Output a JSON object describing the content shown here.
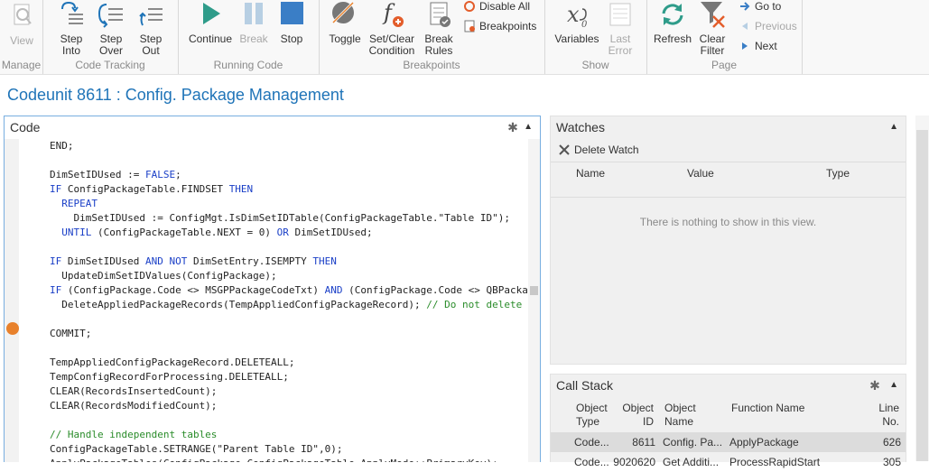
{
  "ribbon": {
    "manage": {
      "label": "Manage",
      "view": "View"
    },
    "code_tracking": {
      "label": "Code Tracking",
      "step_into": [
        "Step",
        "Into"
      ],
      "step_over": [
        "Step",
        "Over"
      ],
      "step_out": [
        "Step",
        "Out"
      ]
    },
    "running_code": {
      "label": "Running Code",
      "continue": "Continue",
      "break": "Break",
      "stop": "Stop"
    },
    "breakpoints": {
      "label": "Breakpoints",
      "toggle": "Toggle",
      "set_clear": [
        "Set/Clear",
        "Condition"
      ],
      "break_rules": [
        "Break",
        "Rules"
      ],
      "disable_all": "Disable All",
      "breakpoints": "Breakpoints"
    },
    "show": {
      "label": "Show",
      "variables": "Variables",
      "last_error": [
        "Last",
        "Error"
      ]
    },
    "page": {
      "label": "Page",
      "refresh": "Refresh",
      "clear_filter": [
        "Clear",
        "Filter"
      ],
      "go_to": "Go to",
      "previous": "Previous",
      "next": "Next"
    }
  },
  "page_title": "Codeunit 8611 : Config. Package Management",
  "code_panel": {
    "title": "Code",
    "lines": [
      [
        [
          "",
          "END;"
        ]
      ],
      [
        [
          "",
          ""
        ]
      ],
      [
        [
          "",
          "DimSetIDUsed := "
        ],
        [
          "kw",
          "FALSE"
        ],
        [
          "",
          ";"
        ]
      ],
      [
        [
          "kw",
          "IF"
        ],
        [
          "",
          " ConfigPackageTable.FINDSET "
        ],
        [
          "kw",
          "THEN"
        ]
      ],
      [
        [
          "kw",
          "  REPEAT"
        ]
      ],
      [
        [
          "",
          "    DimSetIDUsed := ConfigMgt.IsDimSetIDTable(ConfigPackageTable.\"Table ID\");"
        ]
      ],
      [
        [
          "kw",
          "  UNTIL"
        ],
        [
          "",
          " (ConfigPackageTable.NEXT = 0) "
        ],
        [
          "kw",
          "OR"
        ],
        [
          "",
          " DimSetIDUsed;"
        ]
      ],
      [
        [
          "",
          ""
        ]
      ],
      [
        [
          "kw",
          "IF"
        ],
        [
          "",
          " DimSetIDUsed "
        ],
        [
          "kw",
          "AND NOT"
        ],
        [
          "",
          " DimSetEntry.ISEMPTY "
        ],
        [
          "kw",
          "THEN"
        ]
      ],
      [
        [
          "",
          "  UpdateDimSetIDValues(ConfigPackage);"
        ]
      ],
      [
        [
          "kw",
          "IF"
        ],
        [
          "",
          " (ConfigPackage.Code <> MSGPPackageCodeTxt) "
        ],
        [
          "kw",
          "AND"
        ],
        [
          "",
          " (ConfigPackage.Code <> QBPacka"
        ]
      ],
      [
        [
          "",
          "  DeleteAppliedPackageRecords(TempAppliedConfigPackageRecord); "
        ],
        [
          "cm",
          "// Do not delete"
        ]
      ],
      [
        [
          "",
          ""
        ]
      ],
      [
        [
          "",
          "COMMIT;"
        ]
      ],
      [
        [
          "",
          ""
        ]
      ],
      [
        [
          "",
          "TempAppliedConfigPackageRecord.DELETEALL;"
        ]
      ],
      [
        [
          "",
          "TempConfigRecordForProcessing.DELETEALL;"
        ]
      ],
      [
        [
          "",
          "CLEAR(RecordsInsertedCount);"
        ]
      ],
      [
        [
          "",
          "CLEAR(RecordsModifiedCount);"
        ]
      ],
      [
        [
          "",
          ""
        ]
      ],
      [
        [
          "cm",
          "// Handle independent tables"
        ]
      ],
      [
        [
          "",
          "ConfigPackageTable.SETRANGE(\"Parent Table ID\",0);"
        ]
      ],
      [
        [
          "",
          "ApplyPackageTables(ConfigPackage,ConfigPackageTable,ApplyMode::PrimaryKey);"
        ]
      ]
    ]
  },
  "watches": {
    "title": "Watches",
    "delete_watch": "Delete Watch",
    "columns": [
      "Name",
      "Value",
      "Type"
    ],
    "empty_text": "There is nothing to show in this view."
  },
  "call_stack": {
    "title": "Call Stack",
    "columns": [
      [
        "Object",
        "Type"
      ],
      [
        "Object",
        "ID"
      ],
      [
        "Object",
        "Name"
      ],
      [
        "Function Name"
      ],
      [
        "Line",
        "No."
      ]
    ],
    "rows": [
      {
        "type": "Code...",
        "id": "8611",
        "name": "Config. Pa...",
        "function": "ApplyPackage",
        "line": "626"
      },
      {
        "type": "Code...",
        "id": "9020620",
        "name": "Get Additi...",
        "function": "ProcessRapidStart",
        "line": "305"
      }
    ]
  }
}
